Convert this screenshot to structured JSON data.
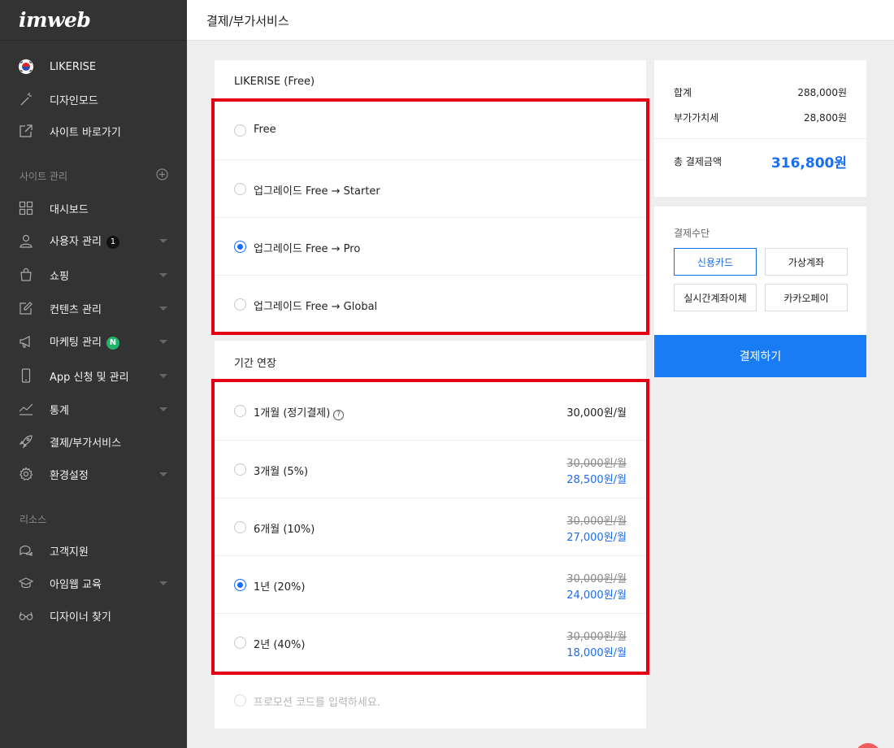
{
  "app": {
    "logo": "imweb"
  },
  "sidebar": {
    "site_name": "LIKERISE",
    "design_mode": "디자인모드",
    "goto_site": "사이트 바로가기",
    "site_manage_heading": "사이트 관리",
    "items": [
      {
        "label": "대시보드"
      },
      {
        "label": "사용자 관리",
        "badge": "1"
      },
      {
        "label": "쇼핑"
      },
      {
        "label": "컨텐츠 관리"
      },
      {
        "label": "마케팅 관리",
        "badge": "N"
      },
      {
        "label": "App 신청 및 관리"
      },
      {
        "label": "통계"
      },
      {
        "label": "결제/부가서비스"
      },
      {
        "label": "환경설정"
      }
    ],
    "resources_heading": "리소스",
    "resources": [
      {
        "label": "고객지원"
      },
      {
        "label": "아임웹 교육"
      },
      {
        "label": "디자이너 찾기"
      }
    ]
  },
  "header": {
    "title": "결제/부가서비스"
  },
  "plan": {
    "title": "LIKERISE (Free)",
    "options": [
      {
        "label": "Free",
        "checked": false
      },
      {
        "label": "업그레이드 Free → Starter",
        "checked": false
      },
      {
        "label": "업그레이드 Free → Pro",
        "checked": true
      },
      {
        "label": "업그레이드 Free → Global",
        "checked": false
      }
    ]
  },
  "period": {
    "title": "기간 연장",
    "help": "?",
    "options": [
      {
        "label": "1개월 (정기결제)",
        "price": "30,000원/월",
        "checked": false
      },
      {
        "label": "3개월 (5%)",
        "old_price": "30,000원/월",
        "price": "28,500원/월",
        "checked": false
      },
      {
        "label": "6개월 (10%)",
        "old_price": "30,000원/월",
        "price": "27,000원/월",
        "checked": false
      },
      {
        "label": "1년 (20%)",
        "old_price": "30,000원/월",
        "price": "24,000원/월",
        "checked": true
      },
      {
        "label": "2년 (40%)",
        "old_price": "30,000원/월",
        "price": "18,000원/월",
        "checked": false
      }
    ],
    "promo_placeholder": "프로모션 코드를 입력하세요."
  },
  "summary": {
    "subtotal_label": "합계",
    "subtotal": "288,000원",
    "vat_label": "부가가치세",
    "vat": "28,800원",
    "total_label": "총 결제금액",
    "total": "316,800원"
  },
  "payment": {
    "title": "결제수단",
    "methods": [
      "신용카드",
      "가상계좌",
      "실시간계좌이체",
      "카카오페이"
    ],
    "selected_method": "신용카드",
    "checkout_label": "결제하기"
  },
  "colors": {
    "accent": "#1a6cf5",
    "highlight_box": "#e40012",
    "sidebar_bg": "#333333"
  }
}
